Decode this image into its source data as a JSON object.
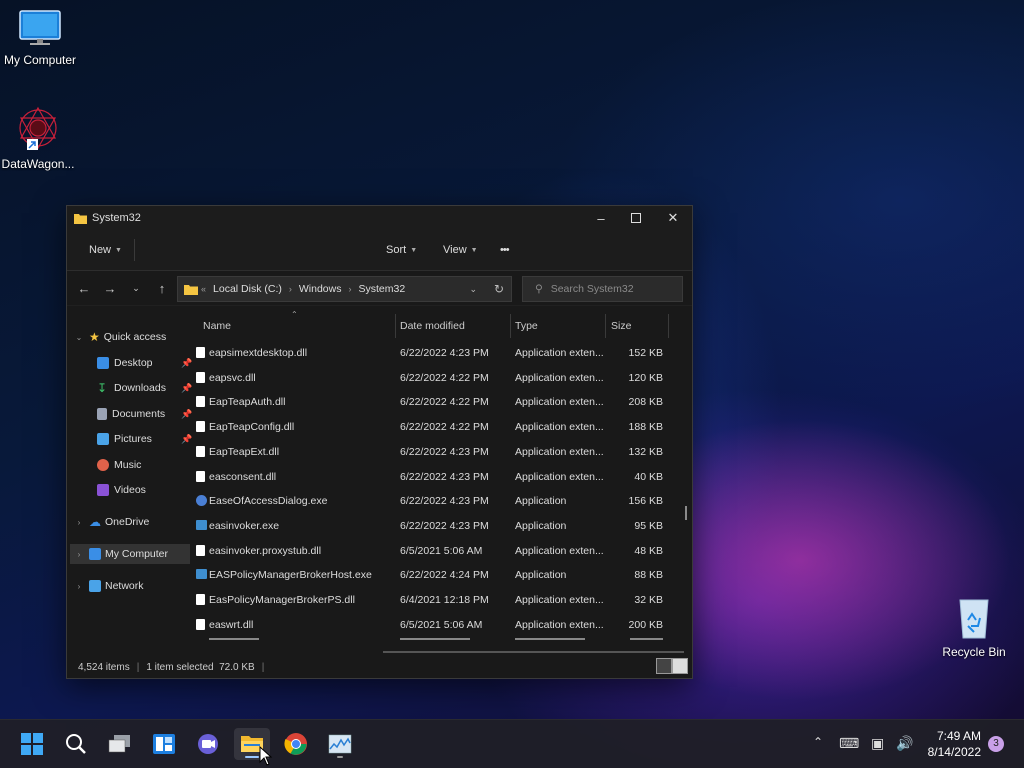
{
  "desktop": {
    "icons": [
      {
        "label": "My Computer"
      },
      {
        "label": "DataWagon..."
      },
      {
        "label": "Recycle Bin"
      }
    ]
  },
  "window": {
    "title": "System32",
    "commands": {
      "new": "New",
      "sort": "Sort",
      "view": "View",
      "more": "•••"
    },
    "address": {
      "crumbs": [
        "Local Disk (C:)",
        "Windows",
        "System32"
      ],
      "overflow": "«"
    },
    "search_placeholder": "Search System32",
    "sidebar": [
      {
        "label": "Quick access",
        "pinned": false
      },
      {
        "label": "Desktop",
        "pinned": true
      },
      {
        "label": "Downloads",
        "pinned": true
      },
      {
        "label": "Documents",
        "pinned": true
      },
      {
        "label": "Pictures",
        "pinned": true
      },
      {
        "label": "Music",
        "pinned": false
      },
      {
        "label": "Videos",
        "pinned": false
      },
      {
        "label": "OneDrive",
        "pinned": false
      },
      {
        "label": "My Computer",
        "pinned": false
      },
      {
        "label": "Network",
        "pinned": false
      }
    ],
    "columns": {
      "name": "Name",
      "date": "Date modified",
      "type": "Type",
      "size": "Size"
    },
    "files": [
      {
        "name": "eapsimextdesktop.dll",
        "date": "6/22/2022 4:23 PM",
        "type": "Application exten...",
        "size": "152 KB"
      },
      {
        "name": "eapsvc.dll",
        "date": "6/22/2022 4:22 PM",
        "type": "Application exten...",
        "size": "120 KB"
      },
      {
        "name": "EapTeapAuth.dll",
        "date": "6/22/2022 4:22 PM",
        "type": "Application exten...",
        "size": "208 KB"
      },
      {
        "name": "EapTeapConfig.dll",
        "date": "6/22/2022 4:22 PM",
        "type": "Application exten...",
        "size": "188 KB"
      },
      {
        "name": "EapTeapExt.dll",
        "date": "6/22/2022 4:23 PM",
        "type": "Application exten...",
        "size": "132 KB"
      },
      {
        "name": "easconsent.dll",
        "date": "6/22/2022 4:23 PM",
        "type": "Application exten...",
        "size": "40 KB"
      },
      {
        "name": "EaseOfAccessDialog.exe",
        "date": "6/22/2022 4:23 PM",
        "type": "Application",
        "size": "156 KB"
      },
      {
        "name": "easinvoker.exe",
        "date": "6/22/2022 4:23 PM",
        "type": "Application",
        "size": "95 KB"
      },
      {
        "name": "easinvoker.proxystub.dll",
        "date": "6/5/2021 5:06 AM",
        "type": "Application exten...",
        "size": "48 KB"
      },
      {
        "name": "EASPolicyManagerBrokerHost.exe",
        "date": "6/22/2022 4:24 PM",
        "type": "Application",
        "size": "88 KB"
      },
      {
        "name": "EasPolicyManagerBrokerPS.dll",
        "date": "6/4/2021 12:18 PM",
        "type": "Application exten...",
        "size": "32 KB"
      },
      {
        "name": "easwrt.dll",
        "date": "6/5/2021 5:06 AM",
        "type": "Application exten...",
        "size": "200 KB"
      }
    ],
    "status": {
      "count": "4,524 items",
      "selected": "1 item selected  72.0 KB"
    }
  },
  "taskbar": {
    "time": "7:49 AM",
    "date": "8/14/2022",
    "notifications": "3"
  }
}
